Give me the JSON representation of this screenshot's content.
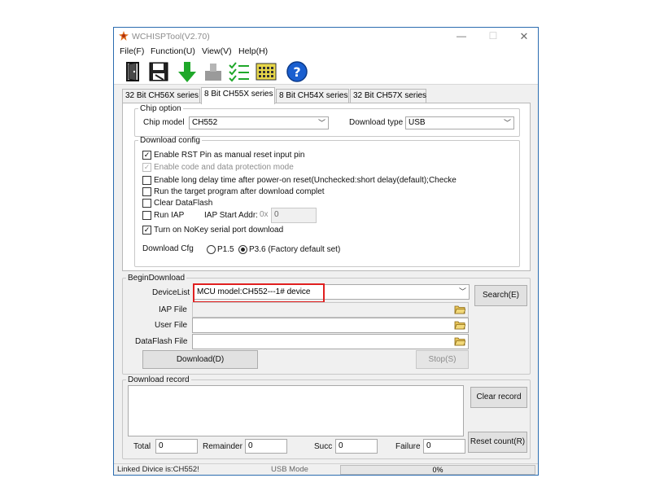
{
  "window": {
    "title": "WCHISPTool(V2.70)",
    "controls": {
      "minimize": "—",
      "maximize": "☐",
      "close": "✕"
    }
  },
  "menu": [
    {
      "label": "File(F)"
    },
    {
      "label": "Function(U)"
    },
    {
      "label": "View(V)"
    },
    {
      "label": "Help(H)"
    }
  ],
  "toolbar": {
    "icons": [
      "open-door-icon",
      "save-icon",
      "download-arrow-icon",
      "chip-icon",
      "checklist-icon",
      "calculator-icon",
      "help-icon"
    ],
    "help_glyph": "?"
  },
  "tabs": [
    {
      "label": "32 Bit CH56X series",
      "active": false
    },
    {
      "label": "8 Bit CH55X series",
      "active": true
    },
    {
      "label": "8 Bit CH54X series",
      "active": false
    },
    {
      "label": "32 Bit CH57X series",
      "active": false
    }
  ],
  "chip_option": {
    "legend": "Chip option",
    "chip_model_label": "Chip model",
    "chip_model_value": "CH552",
    "download_type_label": "Download type",
    "download_type_value": "USB"
  },
  "download_config": {
    "legend": "Download config",
    "checks": [
      {
        "label": "Enable RST Pin as manual reset input pin",
        "checked": true,
        "disabled": false,
        "mark": "✓"
      },
      {
        "label": "Enable code and data protection mode",
        "checked": true,
        "disabled": true,
        "mark": "✓"
      },
      {
        "label": "Enable long delay time after power-on reset(Unchecked:short delay(default);Checke",
        "checked": false,
        "disabled": false,
        "mark": ""
      },
      {
        "label": "Run the target program after download complet",
        "checked": false,
        "disabled": false,
        "mark": ""
      },
      {
        "label": "Clear DataFlash",
        "checked": false,
        "disabled": false,
        "mark": ""
      },
      {
        "label": "Run IAP",
        "checked": false,
        "disabled": false,
        "mark": ""
      },
      {
        "label": "Turn on NoKey serial port download",
        "checked": true,
        "disabled": false,
        "mark": "✓"
      }
    ],
    "iap_start_addr_label": "IAP Start Addr:",
    "iap_prefix": "0x",
    "iap_value": "0",
    "cfg_label": "Download Cfg",
    "cfg_options": [
      {
        "label": "P1.5",
        "selected": false
      },
      {
        "label": "P3.6 (Factory default set)",
        "selected": true
      }
    ]
  },
  "begin_download": {
    "legend": "BeginDownload",
    "device_list_label": "DeviceList",
    "device_list_value": "MCU model:CH552---1# device",
    "search_button": "Search(E)",
    "iap_file_label": "IAP File",
    "iap_file_value": "",
    "user_file_label": "User File",
    "user_file_value": "",
    "dataflash_file_label": "DataFlash File",
    "dataflash_file_value": "",
    "download_button": "Download(D)",
    "stop_button": "Stop(S)"
  },
  "download_record": {
    "legend": "Download record",
    "clear_button": "Clear record",
    "reset_button": "Reset count(R)",
    "total_label": "Total",
    "total_value": "0",
    "remainder_label": "Remainder",
    "remainder_value": "0",
    "succ_label": "Succ",
    "succ_value": "0",
    "failure_label": "Failure",
    "failure_value": "0"
  },
  "status": {
    "linked": "Linked Divice is:CH552!",
    "mode": "USB Mode",
    "progress_percent": 0,
    "progress_text": "0%"
  },
  "colors": {
    "highlight_border": "#e02020",
    "window_border": "#2b6cb0",
    "progress_fill": "#06b025"
  }
}
